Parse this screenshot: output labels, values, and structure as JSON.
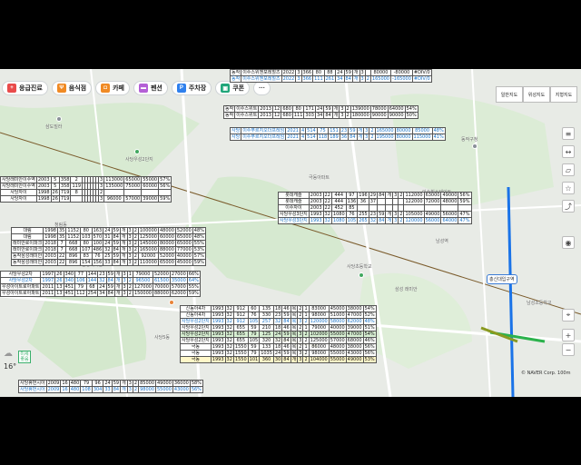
{
  "chips": [
    {
      "label": "응급진료",
      "icon": "plus-icon",
      "color": "#e94b4b"
    },
    {
      "label": "음식점",
      "icon": "fork-icon",
      "color": "#f08a24"
    },
    {
      "label": "카페",
      "icon": "cup-icon",
      "color": "#f08a24"
    },
    {
      "label": "펜션",
      "icon": "bed-icon",
      "color": "#b45fd6"
    },
    {
      "label": "주차장",
      "icon": "p-icon",
      "color": "#2f80ed"
    },
    {
      "label": "쿠폰",
      "icon": "ticket-icon",
      "color": "#20a67a"
    }
  ],
  "more_chip": "···",
  "map_types": [
    "일반지도",
    "위성지도",
    "지형지도"
  ],
  "controls": [
    "layers-icon",
    "distance-icon",
    "area-icon",
    "save-icon",
    "share-icon",
    "roadview-icon",
    "location-icon",
    "zoom-in-icon",
    "zoom-out-icon"
  ],
  "weather": {
    "temp": "16°",
    "badge": "미세\n좋음"
  },
  "scale_text": "© NAVER Corp.  100m",
  "station_label": "총신대입구역",
  "places": [
    "삼도빌라",
    "사당우성2단지",
    "사당휴먼시아",
    "청림동",
    "삼성래미안",
    "사당5동",
    "극동아파트",
    "동작구청",
    "이수역",
    "사당우성3단지",
    "사당 자이",
    "남성역",
    "사당초등학교",
    "삼성 래미안",
    "이수힐스테이트",
    "이수자이",
    "신동아4차",
    "대림아파트",
    "남성초등학교",
    "래미안"
  ],
  "tables": [
    {
      "id": "top",
      "rows": [
        [
          "동작",
          "이수스위첸포레힐즈",
          "2022",
          "3",
          "366",
          "80",
          "88",
          "24",
          "59",
          "개",
          "3",
          "",
          "80000",
          "-80000",
          "#DIV/0"
        ],
        [
          "동작",
          "이수스위첸포레힐즈",
          "2022",
          "3",
          "366",
          "111",
          "261",
          "34",
          "84",
          "개",
          "3",
          "2",
          "165000",
          "-165000",
          "#DIV/0"
        ]
      ],
      "styles": [
        "",
        "blue"
      ]
    },
    {
      "id": "isu-1",
      "rows": [
        [
          "동작",
          "이수스위트",
          "2013",
          "12",
          "680",
          "80",
          "171",
          "24",
          "59",
          "개",
          "3",
          "2",
          "139000",
          "78000",
          "64000",
          "54%"
        ],
        [
          "동작",
          "이수스위트",
          "2013",
          "12",
          "680",
          "111",
          "303",
          "34",
          "84",
          "개",
          "3",
          "2",
          "180000",
          "90000",
          "90000",
          "50%"
        ]
      ],
      "styles": [
        "",
        ""
      ]
    },
    {
      "id": "isu-2",
      "rows": [
        [
          "사당",
          "이수푸르지오더프레임",
          "2021",
          "4",
          "514",
          "75",
          "151",
          "23",
          "59",
          "개",
          "3",
          "2",
          "165000",
          "80000",
          "85000",
          "48%"
        ],
        [
          "사당",
          "이수푸르지오더프레임",
          "2021",
          "4",
          "514",
          "118",
          "189",
          "36",
          "84",
          "개",
          "3",
          "2",
          "195000",
          "80000",
          "115000",
          "41%"
        ]
      ],
      "styles": [
        "blue",
        "blue"
      ]
    },
    {
      "id": "left-1",
      "rows": [
        [
          "사당래미안이수역",
          "2003",
          "5",
          "358",
          "2",
          "",
          "",
          "",
          "",
          "",
          "",
          "3",
          "113000",
          "65000",
          "55000",
          "57%"
        ],
        [
          "사당래미안이수역",
          "2003",
          "5",
          "358",
          "119",
          "",
          "",
          "",
          "",
          "",
          "",
          "3",
          "135000",
          "75000",
          "60000",
          "56%"
        ],
        [
          "사당자이",
          "1998",
          "26",
          "719",
          "8",
          "",
          "",
          "",
          "",
          "",
          "",
          "2",
          "",
          "",
          "",
          ""
        ],
        [
          "사당자이",
          "1998",
          "26",
          "719",
          "",
          "",
          "",
          "",
          "",
          "",
          "",
          "3",
          "96000",
          "57000",
          "39000",
          "59%"
        ]
      ],
      "styles": [
        "",
        "",
        "",
        ""
      ]
    },
    {
      "id": "left-2",
      "rows": [
        [
          "대림",
          "1998",
          "35",
          "1152",
          "80",
          "163",
          "24",
          "59",
          "개",
          "3",
          "2",
          "100000",
          "48000",
          "52000",
          "48%"
        ],
        [
          "대림",
          "1998",
          "35",
          "1152",
          "103",
          "570",
          "31",
          "84",
          "개",
          "3",
          "2",
          "125000",
          "60000",
          "65000",
          "48%"
        ],
        [
          "래미안로이파크",
          "2018",
          "7",
          "668",
          "80",
          "100",
          "24",
          "59",
          "개",
          "3",
          "2",
          "145000",
          "80000",
          "65000",
          "55%"
        ],
        [
          "래미안로이파크",
          "2018",
          "7",
          "668",
          "107",
          "486",
          "32",
          "84",
          "개",
          "3",
          "2",
          "165000",
          "88000",
          "77000",
          "53%"
        ],
        [
          "동작삼성래미안",
          "2003",
          "22",
          "896",
          "83",
          "76",
          "25",
          "59",
          "개",
          "3",
          "2",
          "92000",
          "52000",
          "40000",
          "57%"
        ],
        [
          "동작삼성래미안",
          "2003",
          "22",
          "896",
          "154",
          "156",
          "33",
          "84",
          "개",
          "3",
          "2",
          "110000",
          "65000",
          "45000",
          "59%"
        ]
      ],
      "styles": [
        "",
        "",
        "",
        "",
        "",
        ""
      ]
    },
    {
      "id": "left-3",
      "rows": [
        [
          "사당우성2차",
          "1997",
          "26",
          "340",
          "77",
          "144",
          "23",
          "59",
          "개",
          "3",
          "1",
          "79000",
          "52000",
          "27000",
          "66%"
        ],
        [
          "사당우성2차",
          "1997",
          "26",
          "340",
          "106",
          "144",
          "32",
          "84",
          "개",
          "3",
          "2",
          "96500",
          "61500",
          "35000",
          "64%"
        ],
        [
          "우성아이트로아파트",
          "2011",
          "13",
          "451",
          "79",
          "68",
          "24",
          "59",
          "개",
          "3",
          "2",
          "127000",
          "70000",
          "57000",
          "55%"
        ],
        [
          "우성아이트로아파트",
          "2011",
          "13",
          "451",
          "112",
          "254",
          "34",
          "84",
          "개",
          "3",
          "2",
          "150000",
          "88000",
          "62000",
          "59%"
        ]
      ],
      "styles": [
        "",
        "blue",
        "",
        ""
      ]
    },
    {
      "id": "mid",
      "rows": [
        [
          "롯데캐슬",
          "2003",
          "22",
          "444",
          "97",
          "196",
          "29",
          "84",
          "개",
          "3",
          "2",
          "112000",
          "63000",
          "49000",
          "56%"
        ],
        [
          "롯데캐슬",
          "2003",
          "22",
          "444",
          "136",
          "36",
          "37",
          "",
          "",
          "",
          "",
          "122000",
          "72000",
          "48000",
          "59%"
        ],
        [
          "이수자이",
          "2003",
          "22",
          "452",
          "85",
          "",
          "",
          "",
          "",
          "",
          "",
          "",
          "",
          "",
          ""
        ],
        [
          "사당우성3단지",
          "1993",
          "32",
          "1080",
          "76",
          "255",
          "23",
          "59",
          "개",
          "3",
          "2",
          "105000",
          "49000",
          "56000",
          "47%"
        ],
        [
          "사당우성3단지",
          "1993",
          "32",
          "1080",
          "105",
          "265",
          "32",
          "84",
          "개",
          "3",
          "2",
          "120000",
          "56000",
          "64000",
          "47%"
        ]
      ],
      "styles": [
        "",
        "",
        "",
        "",
        "blue"
      ]
    },
    {
      "id": "bottom-1",
      "rows": [
        [
          "신동아4차",
          "1993",
          "32",
          "912",
          "60",
          "135",
          "18",
          "46",
          "복",
          "2",
          "1",
          "83000",
          "45000",
          "38000",
          "54%"
        ],
        [
          "신동아4차",
          "1993",
          "32",
          "912",
          "76",
          "330",
          "23",
          "59",
          "복",
          "2",
          "1",
          "98000",
          "51000",
          "47000",
          "52%"
        ],
        [
          "사당우성2단지",
          "1993",
          "32",
          "912",
          "105",
          "257",
          "32",
          "84",
          "복",
          "3",
          "2",
          "120000",
          "58000",
          "62000",
          "48%"
        ],
        [
          "사당우성2단지",
          "1993",
          "32",
          "655",
          "59",
          "210",
          "18",
          "46",
          "복",
          "2",
          "1",
          "79000",
          "40000",
          "39000",
          "51%"
        ],
        [
          "사당우성2단지",
          "1993",
          "32",
          "655",
          "79",
          "125",
          "24",
          "59",
          "복",
          "3",
          "2",
          "102000",
          "55000",
          "47000",
          "54%"
        ],
        [
          "사당우성2단지",
          "1993",
          "32",
          "655",
          "105",
          "320",
          "32",
          "84",
          "복",
          "3",
          "2",
          "125000",
          "57000",
          "68000",
          "46%"
        ],
        [
          "극동",
          "1993",
          "32",
          "1550",
          "59",
          "133",
          "18",
          "46",
          "복",
          "2",
          "1",
          "86000",
          "48000",
          "38000",
          "56%"
        ],
        [
          "극동",
          "1993",
          "32",
          "1550",
          "79",
          "1035",
          "24",
          "59",
          "복",
          "3",
          "2",
          "98000",
          "55000",
          "43000",
          "56%"
        ],
        [
          "극동",
          "1993",
          "32",
          "1550",
          "101",
          "360",
          "30",
          "84",
          "개",
          "3",
          "2",
          "104000",
          "55000",
          "49000",
          "53%"
        ]
      ],
      "styles": [
        "",
        "",
        "blue",
        "",
        "green",
        "",
        "",
        "",
        "yellow"
      ]
    },
    {
      "id": "bottom-left",
      "rows": [
        [
          "사당휴먼시아",
          "2009",
          "16",
          "480",
          "79",
          "96",
          "24",
          "59",
          "개",
          "3",
          "2",
          "85000",
          "49000",
          "36000",
          "58%"
        ],
        [
          "사당휴먼시아",
          "2009",
          "16",
          "480",
          "108",
          "304",
          "33",
          "84",
          "개",
          "3",
          "2",
          "98000",
          "55000",
          "43000",
          "56%"
        ]
      ],
      "styles": [
        "",
        "blue"
      ]
    }
  ]
}
